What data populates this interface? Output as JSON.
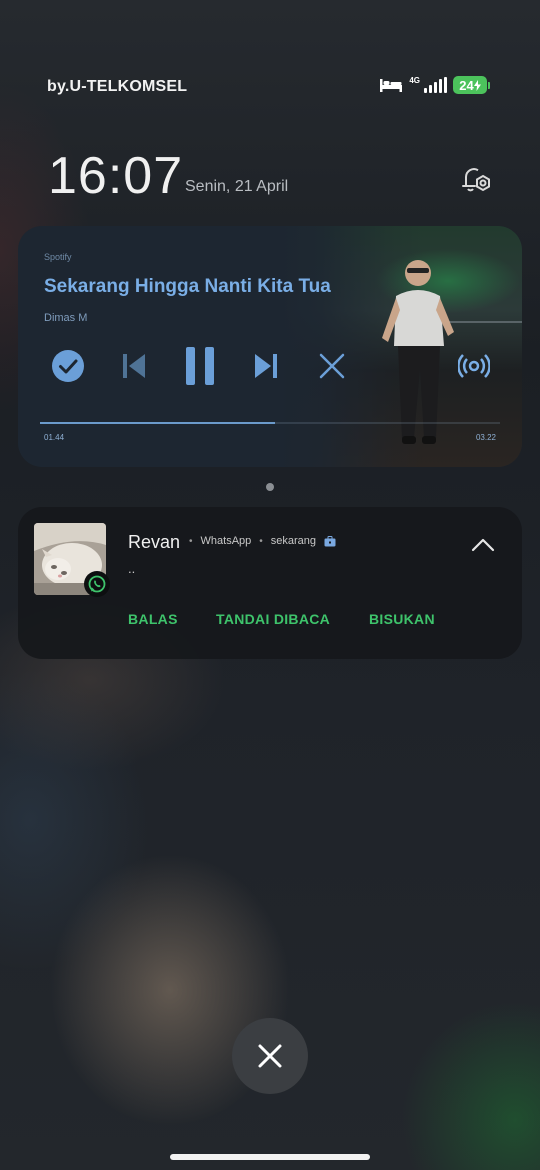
{
  "status_bar": {
    "carrier": "by.U-TELKOMSEL",
    "network_label": "4G",
    "battery_level": "24",
    "icons": [
      "bed-icon",
      "signal-icon",
      "charging-icon"
    ]
  },
  "lockscreen": {
    "time": "16:07",
    "date": "Senin, 21 April"
  },
  "media": {
    "app": "Spotify",
    "title": "Sekarang Hingga Nanti Kita Tua",
    "artist": "Dimas M",
    "elapsed": "01.44",
    "duration": "03.22",
    "progress_fraction": 0.51,
    "accent_color": "#7aaee6",
    "controls": [
      "check-icon",
      "previous-icon",
      "pause-icon",
      "next-icon",
      "close-icon",
      "cast-icon"
    ]
  },
  "notification": {
    "sender": "Revan",
    "app": "WhatsApp",
    "time": "sekarang",
    "message": "..",
    "actions": {
      "reply": "BALAS",
      "mark_read": "TANDAI DIBACA",
      "mute": "BISUKAN"
    },
    "action_color": "#3ec36b"
  }
}
